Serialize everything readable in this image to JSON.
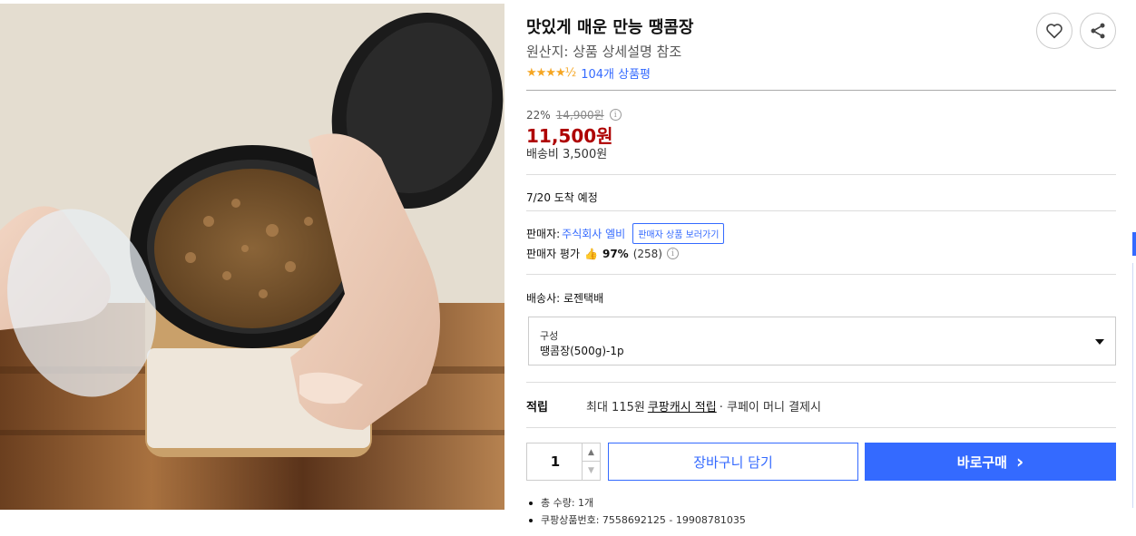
{
  "product": {
    "title": "맛있게 매운 만능 땡콤장",
    "origin": "원산지: 상품 상세설명 참조",
    "stars": "★★★★½",
    "review_count": "104개 상품평"
  },
  "icons": {
    "wish": "heart-icon",
    "share": "share-icon"
  },
  "price": {
    "discount_rate": "22%",
    "original": "14,900원",
    "info": "i",
    "sale": "11,500원",
    "shipping_fee": "배송비 3,500원"
  },
  "delivery": {
    "arrival": "7/20 도착 예정",
    "carrier": "배송사: 로젠택배"
  },
  "seller": {
    "label": "판매자:",
    "name": "주식회사 엘비",
    "more_button": "판매자 상품 보러가기",
    "rating_label": "판매자 평가",
    "thumb": "👍",
    "rating_pct": "97%",
    "rating_count": "(258)",
    "info": "i"
  },
  "option": {
    "label": "구성",
    "value": "땡콤장(500g)-1p"
  },
  "cash": {
    "label": "적립",
    "prefix": "최대 115원",
    "link": "쿠팡캐시 적립",
    "suffix": "· 쿠페이 머니 결제시"
  },
  "purchase": {
    "quantity": "1",
    "qty_up": "▲",
    "qty_down": "▼",
    "cart_label": "장바구니 담기",
    "buy_label": "바로구매",
    "buy_arrow": "›"
  },
  "meta": {
    "total_qty": "총 수량: 1개",
    "product_no": "쿠팡상품번호: 7558692125 - 19908781035"
  },
  "colors": {
    "accent": "#346aff",
    "sale_price": "#ae0000",
    "star": "#f5a623"
  }
}
